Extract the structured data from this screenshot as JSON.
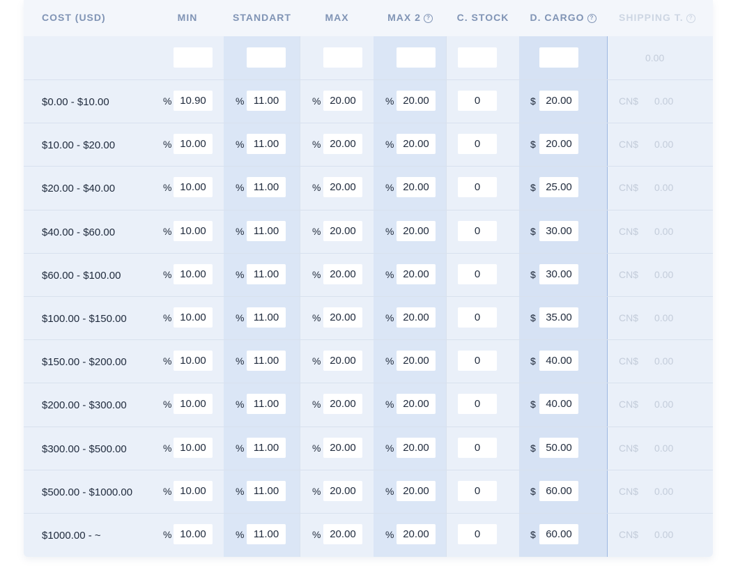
{
  "headers": {
    "cost": "COST (USD)",
    "min": "MIN",
    "standart": "STANDART",
    "max": "MAX",
    "max2": "MAX 2",
    "c_stock": "C. STOCK",
    "d_cargo": "D. CARGO",
    "shipping": "SHIPPING T."
  },
  "help_icon_glyph": "?",
  "top_row": {
    "min": "",
    "standart": "",
    "max": "",
    "max2": "",
    "c_stock": "",
    "d_cargo": "",
    "shipping": "0.00"
  },
  "symbols": {
    "percent": "%",
    "dollar": "$",
    "cn": "CN$"
  },
  "rows": [
    {
      "range": "$0.00 - $10.00",
      "min": "10.90",
      "standart": "11.00",
      "max": "20.00",
      "max2": "20.00",
      "c_stock": "0",
      "d_cargo": "20.00",
      "shipping": "0.00"
    },
    {
      "range": "$10.00 - $20.00",
      "min": "10.00",
      "standart": "11.00",
      "max": "20.00",
      "max2": "20.00",
      "c_stock": "0",
      "d_cargo": "20.00",
      "shipping": "0.00"
    },
    {
      "range": "$20.00 - $40.00",
      "min": "10.00",
      "standart": "11.00",
      "max": "20.00",
      "max2": "20.00",
      "c_stock": "0",
      "d_cargo": "25.00",
      "shipping": "0.00"
    },
    {
      "range": "$40.00 - $60.00",
      "min": "10.00",
      "standart": "11.00",
      "max": "20.00",
      "max2": "20.00",
      "c_stock": "0",
      "d_cargo": "30.00",
      "shipping": "0.00"
    },
    {
      "range": "$60.00 - $100.00",
      "min": "10.00",
      "standart": "11.00",
      "max": "20.00",
      "max2": "20.00",
      "c_stock": "0",
      "d_cargo": "30.00",
      "shipping": "0.00"
    },
    {
      "range": "$100.00 - $150.00",
      "min": "10.00",
      "standart": "11.00",
      "max": "20.00",
      "max2": "20.00",
      "c_stock": "0",
      "d_cargo": "35.00",
      "shipping": "0.00"
    },
    {
      "range": "$150.00 - $200.00",
      "min": "10.00",
      "standart": "11.00",
      "max": "20.00",
      "max2": "20.00",
      "c_stock": "0",
      "d_cargo": "40.00",
      "shipping": "0.00"
    },
    {
      "range": "$200.00 - $300.00",
      "min": "10.00",
      "standart": "11.00",
      "max": "20.00",
      "max2": "20.00",
      "c_stock": "0",
      "d_cargo": "40.00",
      "shipping": "0.00"
    },
    {
      "range": "$300.00 - $500.00",
      "min": "10.00",
      "standart": "11.00",
      "max": "20.00",
      "max2": "20.00",
      "c_stock": "0",
      "d_cargo": "50.00",
      "shipping": "0.00"
    },
    {
      "range": "$500.00 - $1000.00",
      "min": "10.00",
      "standart": "11.00",
      "max": "20.00",
      "max2": "20.00",
      "c_stock": "0",
      "d_cargo": "60.00",
      "shipping": "0.00"
    },
    {
      "range": "$1000.00 - ~",
      "min": "10.00",
      "standart": "11.00",
      "max": "20.00",
      "max2": "20.00",
      "c_stock": "0",
      "d_cargo": "60.00",
      "shipping": "0.00"
    }
  ]
}
